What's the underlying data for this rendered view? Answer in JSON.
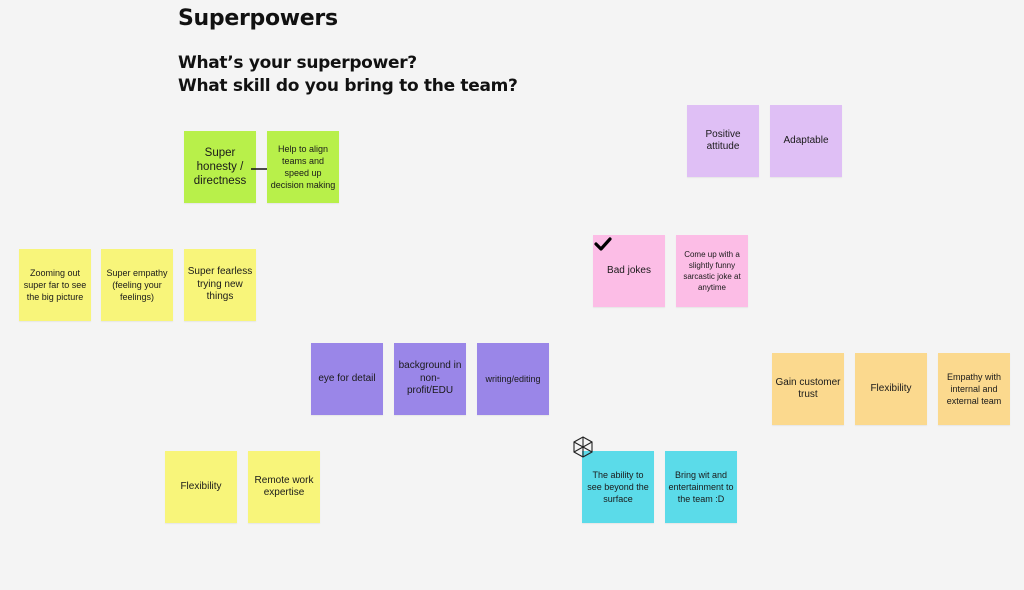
{
  "board": {
    "title": "Superpowers",
    "subtitle_line1": "What’s your superpower?",
    "subtitle_line2": "What skill do you bring to the team?"
  },
  "colors": {
    "green": "#b8f04a",
    "yellow": "#f8f57a",
    "lavender": "#dfbff5",
    "pink": "#fcbde6",
    "purple": "#9a86e8",
    "orange": "#fbd98e",
    "cyan": "#5bdbe9"
  },
  "notes": {
    "green_1": "Super honesty / directness",
    "green_2": "Help to align teams and speed up decision making",
    "yellow_1": "Zooming out super far to see the big picture",
    "yellow_2": "Super empathy (feeling your feelings)",
    "yellow_3": "Super fearless trying new things",
    "yellow_4": "Flexibility",
    "yellow_5": "Remote work expertise",
    "lavender_1": "Positive attitude",
    "lavender_2": "Adaptable",
    "pink_1": "Bad jokes",
    "pink_2": "Come up with a slightly funny sarcastic joke at anytime",
    "purple_1": "eye for detail",
    "purple_2": "background in non-profit/EDU",
    "purple_3": "writing/editing",
    "orange_1": "Gain customer trust",
    "orange_2": "Flexibility",
    "orange_3": "Empathy with internal and external team",
    "cyan_1": "The ability to see beyond the surface",
    "cyan_2": "Bring wit and entertainment to the team :D"
  },
  "icons": {
    "arrow": "arrow-right",
    "check": "checkmark",
    "cube": "cube-cursor"
  }
}
